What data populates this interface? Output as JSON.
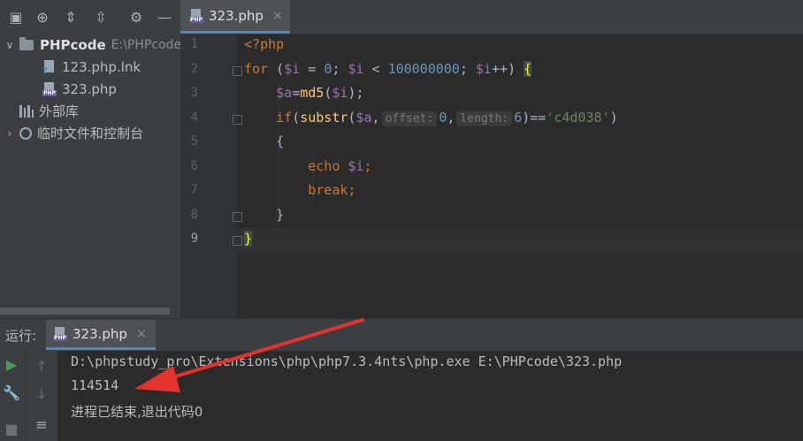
{
  "left_toolbar": {
    "icons": [
      "panel-icon",
      "crosshair-icon",
      "expand-all-icon",
      "collapse-all-icon",
      "gear-icon",
      "minimize-icon"
    ]
  },
  "project_tree": {
    "root": {
      "name": "PHPcode",
      "path": "E:\\PHPcode"
    },
    "files": [
      {
        "name": "123.php.lnk"
      },
      {
        "name": "323.php"
      }
    ],
    "external_libs": "外部库",
    "scratches": "临时文件和控制台"
  },
  "editor": {
    "tab": {
      "label": "323.php",
      "close": "×",
      "icon_tag": "PHP"
    },
    "line_numbers": [
      "1",
      "2",
      "3",
      "4",
      "5",
      "6",
      "7",
      "8",
      "9"
    ],
    "hints": {
      "offset": "offset:",
      "length": "length:"
    }
  },
  "run": {
    "title": "运行:",
    "tab_label": "323.php",
    "tab_close": "×",
    "output": [
      "D:\\phpstudy_pro\\Extensions\\php\\php7.3.4nts\\php.exe E:\\PHPcode\\323.php",
      "114514",
      "进程已结束,退出代码0"
    ]
  },
  "colors": {
    "arrow": "#e5322d",
    "accent": "#4a88c7"
  }
}
